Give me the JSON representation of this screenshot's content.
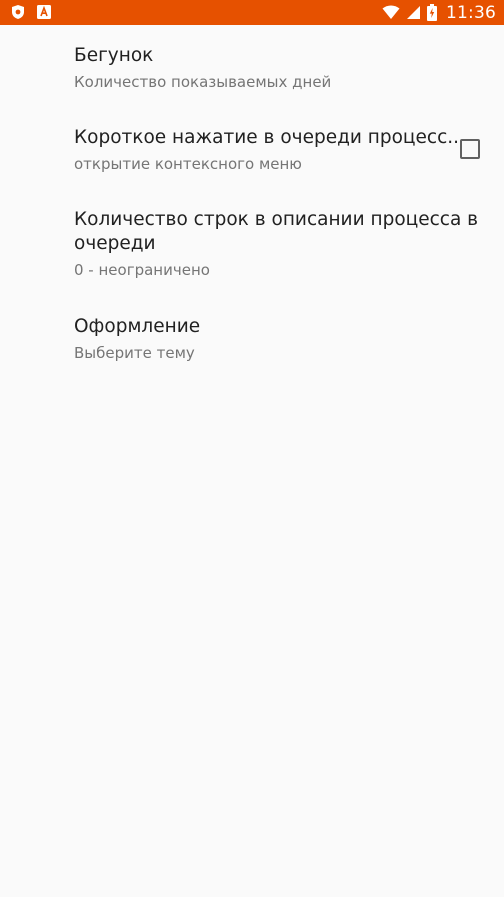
{
  "status_bar": {
    "time": "11:36",
    "icons": [
      "shield-app-icon",
      "font-app-icon",
      "wifi-icon",
      "cellular-signal-icon",
      "battery-charging-icon"
    ],
    "background": "#e65100"
  },
  "preferences": [
    {
      "title": "Бегунок",
      "summary": "Количество показываемых дней"
    },
    {
      "title": "Короткое нажатие в очереди процесс..",
      "summary": "открытие контексного меню",
      "checkbox_checked": false
    },
    {
      "title": "Количество строк в описании процесса в очереди",
      "summary": "0 - неограничено"
    },
    {
      "title": "Оформление",
      "summary": "Выберите тему"
    }
  ]
}
